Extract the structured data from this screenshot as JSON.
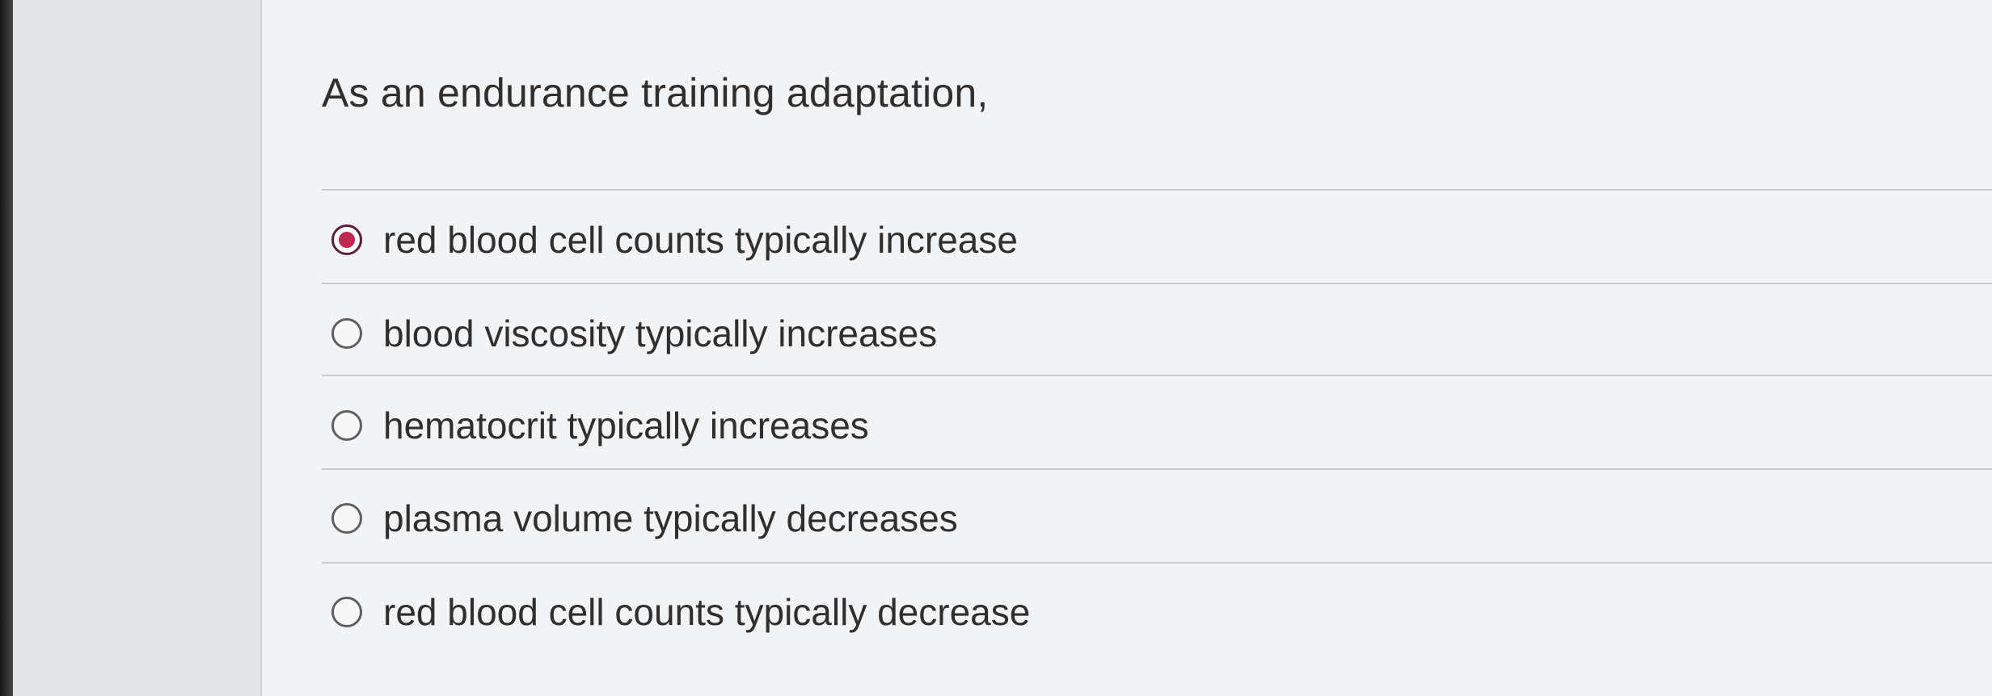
{
  "question": {
    "text": "As an endurance training adaptation,"
  },
  "options": [
    {
      "label": "red blood cell counts typically increase",
      "selected": true
    },
    {
      "label": "blood viscosity typically increases",
      "selected": false
    },
    {
      "label": "hematocrit typically increases",
      "selected": false
    },
    {
      "label": "plasma volume typically decreases",
      "selected": false
    },
    {
      "label": "red blood cell counts typically decrease",
      "selected": false
    }
  ],
  "colors": {
    "selected_radio_fill": "#c0264f",
    "selected_radio_ring": "#5a1f36",
    "text": "#2f2f2f",
    "divider": "#c9cbcd"
  }
}
